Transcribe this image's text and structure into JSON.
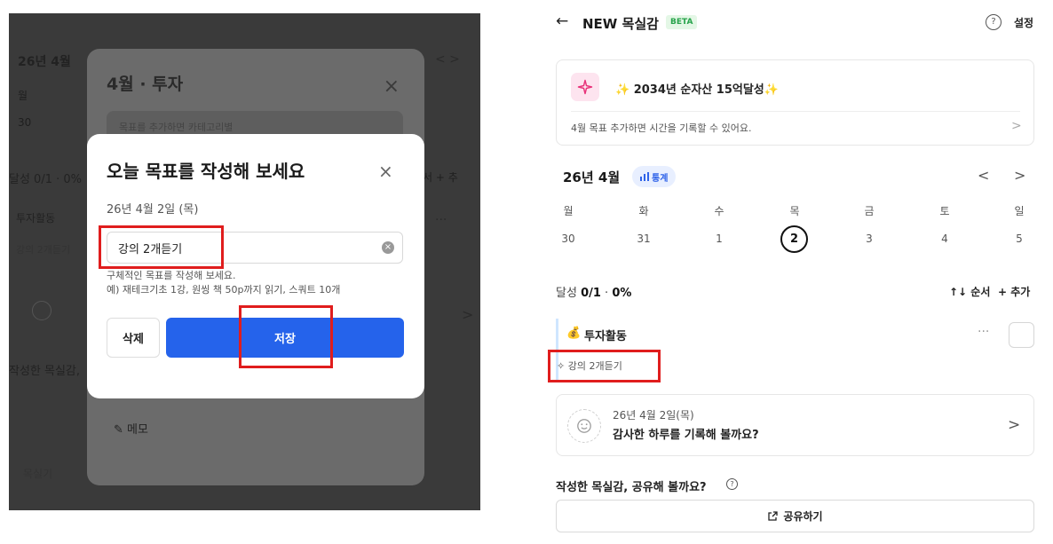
{
  "left": {
    "background": {
      "month": "26년 4월",
      "week_first": "월",
      "day_first": "30",
      "achievement": "달성 0/1 · 0%",
      "order_add": "순서 + 추",
      "category": "투자활동",
      "goal": "강의 2개듣기",
      "write": "작성한 목실감,",
      "mil": "목실기",
      "nav_arrows": "<  >",
      "more": "···",
      "chevron": ">"
    },
    "back_modal": {
      "title": "4월 · 투자",
      "close": "×",
      "hint": "목표를 추가하면 카테고리별",
      "memo": "메모"
    },
    "dialog": {
      "title": "오늘 목표를 작성해 보세요",
      "close": "×",
      "date": "26년 4월 2일 (목)",
      "input_value": "강의 2개듣기",
      "clear": "×",
      "help_line1": "구체적인 목표를 작성해 보세요.",
      "help_line2": "예) 재테크기초 1강, 원씽 책 50p까지 읽기, 스쿼트 10개",
      "delete_label": "삭제",
      "save_label": "저장"
    }
  },
  "right": {
    "header": {
      "back_icon": "←",
      "title": "NEW 목실감",
      "badge": "BETA",
      "help_icon": "?",
      "settings_label": "설정"
    },
    "goal_card": {
      "icon": "sparkle-icon",
      "title": "✨ 2034년 순자산 15억달성✨",
      "subtitle": "4월 목표  추가하면 시간을 기록할 수 있어요.",
      "chevron": ">"
    },
    "calendar": {
      "month_label": "26년 4월",
      "stats_label": "통계",
      "prev": "<",
      "next": ">",
      "weekdays": [
        "월",
        "화",
        "수",
        "목",
        "금",
        "토",
        "일"
      ],
      "days": [
        "30",
        "31",
        "1",
        "2",
        "3",
        "4",
        "5"
      ]
    },
    "achievement": {
      "label": "달성",
      "value": "0/1",
      "percent": "0%",
      "order_label": "↑↓ 순서",
      "add_label": "+ 추가"
    },
    "category": {
      "icon": "💰",
      "name": "투자활동",
      "more": "···",
      "goal_icon": "✧",
      "goal": "강의 2개듣기"
    },
    "diary": {
      "date": "26년 4월 2일(목)",
      "text": "감사한 하루를 기록해 볼까요?",
      "chevron": ">"
    },
    "share": {
      "question": "작성한 목실감, 공유해 볼까요?",
      "info_icon": "?",
      "button_label": "공유하기"
    }
  },
  "colors": {
    "primary_blue": "#2563eb",
    "highlight_red": "#e01d1d",
    "beta_green": "#27a34b"
  }
}
